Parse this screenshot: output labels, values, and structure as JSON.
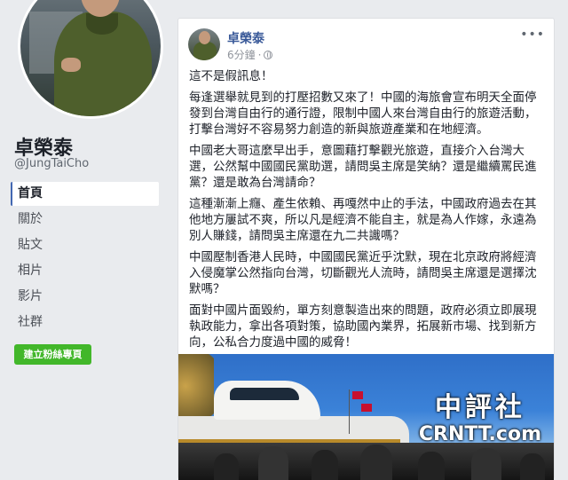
{
  "profile": {
    "name": "卓榮泰",
    "handle": "@JungTaiCho"
  },
  "nav": {
    "items": [
      {
        "label": "首頁",
        "active": true
      },
      {
        "label": "關於",
        "active": false
      },
      {
        "label": "貼文",
        "active": false
      },
      {
        "label": "相片",
        "active": false
      },
      {
        "label": "影片",
        "active": false
      },
      {
        "label": "社群",
        "active": false
      }
    ],
    "create_page_label": "建立粉絲專頁"
  },
  "post": {
    "author": "卓榮泰",
    "time": "6分鐘",
    "paragraphs": [
      "這不是假訊息！",
      "每逢選舉就見到的打壓招數又來了！中國的海旅會宣布明天全面停發到台灣自由行的通行證，限制中國人來台灣自由行的旅遊活動，打擊台灣好不容易努力創造的新與旅遊產業和在地經濟。",
      "中國老大哥這麼早出手，意圖藉打擊觀光旅遊，直接介入台灣大選，公然幫中國國民黨助選，請問吳主席是笑納？還是繼續罵民進黨？還是敢為台灣請命？",
      "這種漸漸上癮、產生依賴、再嘎然中止的手法，中國政府過去在其他地方屢試不爽，所以凡是經濟不能自主，就是為人作嫁，永遠為別人賺錢，請問吳主席還在九二共識嗎？",
      "中國壓制香港人民時，中國國民黨近乎沈默，現在北京政府將經濟入侵魔掌公然指向台灣，切斷觀光人流時，請問吳主席還是選擇沈默嗎？",
      "面對中國片面毀約，單方刻意製造出來的問題，政府必須立即展現執政能力，拿出各項對策，協助國內業界，拓展新市場、找到新方向，公私合力度過中國的威脅！"
    ],
    "more_icon": "•••",
    "globe_icon": "globe-icon"
  },
  "image": {
    "watermark_cn": "中評社",
    "watermark_en": "CRNTT.com"
  },
  "colors": {
    "link": "#385898",
    "create_button": "#42b72a",
    "page_bg": "#e9ebee"
  }
}
